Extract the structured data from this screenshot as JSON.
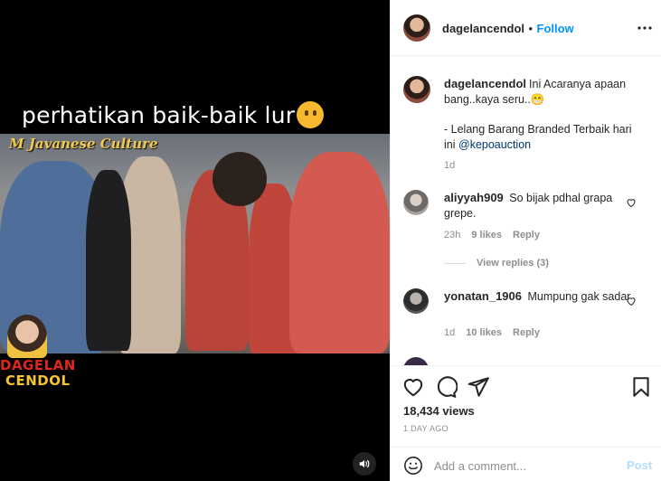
{
  "video": {
    "caption_text": "perhatikan baik-baik lur",
    "caption_emoji": "thinking-face-emoji",
    "watermark_text": "M Javanese Culture",
    "logo_line1": "DAGELAN",
    "logo_line2": "CENDOL",
    "volume_icon": "speaker-icon"
  },
  "header": {
    "username": "dagelancendol",
    "separator": "•",
    "follow_label": "Follow",
    "more_icon": "more-horizontal-icon"
  },
  "comments": [
    {
      "username": "dagelancendol",
      "text_line1": "Ini Acaranya apaan bang..kaya seru..😁",
      "text_line2": "- Lelang Barang Branded Terbaik hari ini",
      "mention": "@kepoauction",
      "time": "1d"
    },
    {
      "username": "aliyyah909",
      "text": "So bijak pdhal grapa grepe.",
      "time": "23h",
      "likes": "9 likes",
      "reply_label": "Reply",
      "view_replies": "View replies (3)"
    },
    {
      "username": "yonatan_1906",
      "text": "Mumpung gak sadar",
      "time": "1d",
      "likes": "10 likes",
      "reply_label": "Reply"
    }
  ],
  "actions": {
    "views": "18,434 views",
    "posted_ago": "1 DAY AGO"
  },
  "add_comment": {
    "placeholder": "Add a comment...",
    "post_label": "Post"
  },
  "colors": {
    "accent": "#0095f6",
    "post_disabled": "#b2dffc",
    "text": "#262626",
    "muted": "#8e8e8e"
  }
}
